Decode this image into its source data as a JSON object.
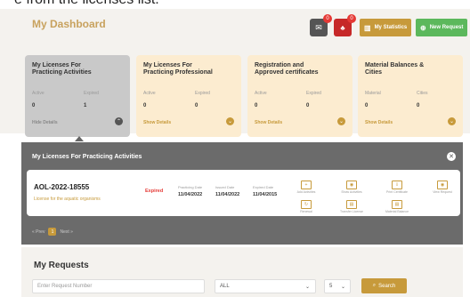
{
  "caption_top": "e from the licenses list:",
  "header": {
    "title": "My Dashboard",
    "mail_badge": "0",
    "alert_badge": "0",
    "statistics_label": "My Statistics",
    "new_request_label": "New Request"
  },
  "cards": [
    {
      "title_line1": "My Licenses For",
      "title_line2": "Practicing Activities",
      "lbl1": "Active",
      "lbl2": "Expired",
      "val1": "0",
      "val2": "1",
      "show": "Hide Details"
    },
    {
      "title_line1": "My Licenses For",
      "title_line2": "Practicing Professional",
      "lbl1": "Active",
      "lbl2": "Expired",
      "val1": "0",
      "val2": "0",
      "show": "Show Details"
    },
    {
      "title_line1": "Registration and",
      "title_line2": "Approved certificates",
      "lbl1": "Active",
      "lbl2": "Expired",
      "val1": "0",
      "val2": "0",
      "show": "Show Details"
    },
    {
      "title_line1": "Material Balances &",
      "title_line2": "Cities",
      "lbl1": "Material",
      "lbl2": "Cities",
      "val1": "0",
      "val2": "0",
      "show": "Show Details"
    }
  ],
  "panel": {
    "title": "My Licenses For Practicing Activities",
    "license": {
      "id": "AOL-2022-18555",
      "subtitle": "License for the aquatic organisms",
      "status": "Expired",
      "practicing_date_label": "Practicing Date",
      "practicing_date": "11/04/2022",
      "issued_date_label": "Issued Date",
      "issued_date": "11/04/2022",
      "expired_date_label": "Expired Date",
      "expired_date": "11/04/2015"
    },
    "actions": [
      {
        "label": "Add Activities",
        "glyph": "+"
      },
      {
        "label": "Show Activities",
        "glyph": "◉"
      },
      {
        "label": "Print Certificate",
        "glyph": "⇩"
      },
      {
        "label": "View Request",
        "glyph": "◉"
      },
      {
        "label": "Renewal",
        "glyph": "↻"
      },
      {
        "label": "Transfer License",
        "glyph": "▤"
      },
      {
        "label": "Material Balance",
        "glyph": "▤"
      }
    ],
    "pager": {
      "prev": "« Prev",
      "current": "1",
      "next": "Next »"
    }
  },
  "requests": {
    "title": "My Requests",
    "placeholder": "Enter Request Number",
    "filter_value": "ALL",
    "page_size": "5",
    "search_label": "Search"
  }
}
